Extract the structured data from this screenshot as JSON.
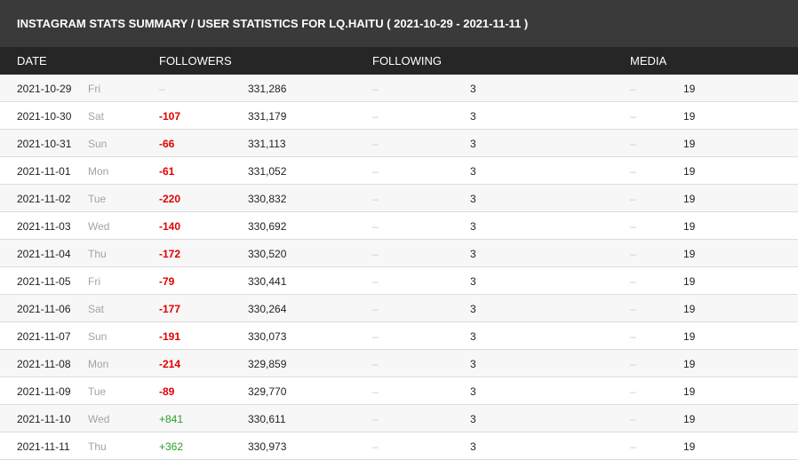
{
  "title": "INSTAGRAM STATS SUMMARY / USER STATISTICS FOR LQ.HAITU ( 2021-10-29 - 2021-11-11 )",
  "columns": {
    "date": "DATE",
    "followers": "FOLLOWERS",
    "following": "FOLLOWING",
    "media": "MEDIA"
  },
  "colors": {
    "negative": "#e00000",
    "positive": "#2a9d2a",
    "header_bg": "#262626",
    "title_bg": "#3a3a3a"
  },
  "rows": [
    {
      "date": "2021-10-29",
      "day": "Fri",
      "followers_delta": "–",
      "followers": "331,286",
      "following_delta": "–",
      "following": "3",
      "media_delta": "–",
      "media": "19"
    },
    {
      "date": "2021-10-30",
      "day": "Sat",
      "followers_delta": "-107",
      "followers": "331,179",
      "following_delta": "–",
      "following": "3",
      "media_delta": "–",
      "media": "19"
    },
    {
      "date": "2021-10-31",
      "day": "Sun",
      "followers_delta": "-66",
      "followers": "331,113",
      "following_delta": "–",
      "following": "3",
      "media_delta": "–",
      "media": "19"
    },
    {
      "date": "2021-11-01",
      "day": "Mon",
      "followers_delta": "-61",
      "followers": "331,052",
      "following_delta": "–",
      "following": "3",
      "media_delta": "–",
      "media": "19"
    },
    {
      "date": "2021-11-02",
      "day": "Tue",
      "followers_delta": "-220",
      "followers": "330,832",
      "following_delta": "–",
      "following": "3",
      "media_delta": "–",
      "media": "19"
    },
    {
      "date": "2021-11-03",
      "day": "Wed",
      "followers_delta": "-140",
      "followers": "330,692",
      "following_delta": "–",
      "following": "3",
      "media_delta": "–",
      "media": "19"
    },
    {
      "date": "2021-11-04",
      "day": "Thu",
      "followers_delta": "-172",
      "followers": "330,520",
      "following_delta": "–",
      "following": "3",
      "media_delta": "–",
      "media": "19"
    },
    {
      "date": "2021-11-05",
      "day": "Fri",
      "followers_delta": "-79",
      "followers": "330,441",
      "following_delta": "–",
      "following": "3",
      "media_delta": "–",
      "media": "19"
    },
    {
      "date": "2021-11-06",
      "day": "Sat",
      "followers_delta": "-177",
      "followers": "330,264",
      "following_delta": "–",
      "following": "3",
      "media_delta": "–",
      "media": "19"
    },
    {
      "date": "2021-11-07",
      "day": "Sun",
      "followers_delta": "-191",
      "followers": "330,073",
      "following_delta": "–",
      "following": "3",
      "media_delta": "–",
      "media": "19"
    },
    {
      "date": "2021-11-08",
      "day": "Mon",
      "followers_delta": "-214",
      "followers": "329,859",
      "following_delta": "–",
      "following": "3",
      "media_delta": "–",
      "media": "19"
    },
    {
      "date": "2021-11-09",
      "day": "Tue",
      "followers_delta": "-89",
      "followers": "329,770",
      "following_delta": "–",
      "following": "3",
      "media_delta": "–",
      "media": "19"
    },
    {
      "date": "2021-11-10",
      "day": "Wed",
      "followers_delta": "+841",
      "followers": "330,611",
      "following_delta": "–",
      "following": "3",
      "media_delta": "–",
      "media": "19"
    },
    {
      "date": "2021-11-11",
      "day": "Thu",
      "followers_delta": "+362",
      "followers": "330,973",
      "following_delta": "–",
      "following": "3",
      "media_delta": "–",
      "media": "19"
    }
  ]
}
